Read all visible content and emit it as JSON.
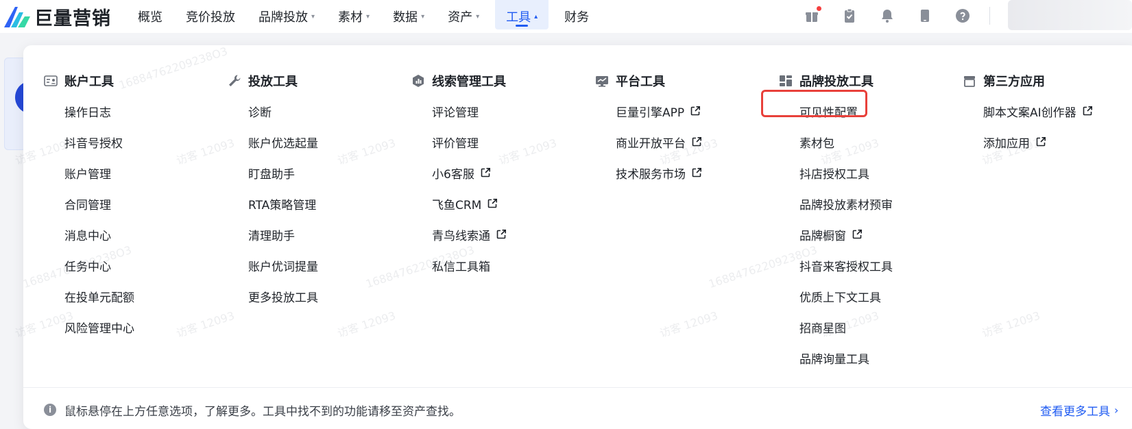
{
  "brand": {
    "name": "巨量营销"
  },
  "nav": [
    {
      "label": "概览",
      "caret": ""
    },
    {
      "label": "竞价投放",
      "caret": ""
    },
    {
      "label": "品牌投放",
      "caret": "▾"
    },
    {
      "label": "素材",
      "caret": "▾"
    },
    {
      "label": "数据",
      "caret": "▾"
    },
    {
      "label": "资产",
      "caret": "▾"
    },
    {
      "label": "工具",
      "caret": "▴",
      "active": true
    },
    {
      "label": "财务",
      "caret": ""
    }
  ],
  "header_icons": [
    "gift-icon",
    "clipboard-check-icon",
    "bell-icon",
    "tablet-icon",
    "help-icon"
  ],
  "dropdown": {
    "columns": [
      {
        "title": "账户工具",
        "icon": "account-tools-icon",
        "items": [
          {
            "label": "操作日志",
            "external": false
          },
          {
            "label": "抖音号授权",
            "external": false
          },
          {
            "label": "账户管理",
            "external": false
          },
          {
            "label": "合同管理",
            "external": false
          },
          {
            "label": "消息中心",
            "external": false
          },
          {
            "label": "任务中心",
            "external": false
          },
          {
            "label": "在投单元配额",
            "external": false
          },
          {
            "label": "风险管理中心",
            "external": false
          }
        ]
      },
      {
        "title": "投放工具",
        "icon": "wrench-icon",
        "items": [
          {
            "label": "诊断",
            "external": false
          },
          {
            "label": "账户优选起量",
            "external": false
          },
          {
            "label": "盯盘助手",
            "external": false
          },
          {
            "label": "RTA策略管理",
            "external": false
          },
          {
            "label": "清理助手",
            "external": false
          },
          {
            "label": "账户优词提量",
            "external": false
          },
          {
            "label": "更多投放工具",
            "external": false
          }
        ]
      },
      {
        "title": "线索管理工具",
        "icon": "leads-icon",
        "items": [
          {
            "label": "评论管理",
            "external": false
          },
          {
            "label": "评价管理",
            "external": false
          },
          {
            "label": "小6客服",
            "external": true
          },
          {
            "label": "飞鱼CRM",
            "external": true
          },
          {
            "label": "青鸟线索通",
            "external": true
          },
          {
            "label": "私信工具箱",
            "external": false
          }
        ]
      },
      {
        "title": "平台工具",
        "icon": "monitor-icon",
        "items": [
          {
            "label": "巨量引擎APP",
            "external": true
          },
          {
            "label": "商业开放平台",
            "external": true
          },
          {
            "label": "技术服务市场",
            "external": true
          }
        ]
      },
      {
        "title": "品牌投放工具",
        "icon": "dashboard-icon",
        "items": [
          {
            "label": "可见性配置",
            "external": false
          },
          {
            "label": "素材包",
            "external": false
          },
          {
            "label": "抖店授权工具",
            "external": false
          },
          {
            "label": "品牌投放素材预审",
            "external": false
          },
          {
            "label": "品牌橱窗",
            "external": true
          },
          {
            "label": "抖音来客授权工具",
            "external": false
          },
          {
            "label": "优质上下文工具",
            "external": false
          },
          {
            "label": "招商星图",
            "external": false
          },
          {
            "label": "品牌询量工具",
            "external": false
          }
        ]
      },
      {
        "title": "第三方应用",
        "icon": "store-icon",
        "items": [
          {
            "label": "脚本文案AI创作器",
            "external": true
          },
          {
            "label": "添加应用",
            "external": true
          }
        ]
      }
    ],
    "footer_text": "鼠标悬停在上方任意选项，了解更多。工具中找不到的功能请移至资产查找。",
    "more_link": "查看更多工具",
    "more_chevron": "›"
  },
  "watermark": {
    "text_a": "访客 12093",
    "text_b": "16884762209238O3"
  },
  "colors": {
    "accent": "#1f5bf2",
    "highlight": "#e8403a",
    "badge": "#f53f3f"
  }
}
